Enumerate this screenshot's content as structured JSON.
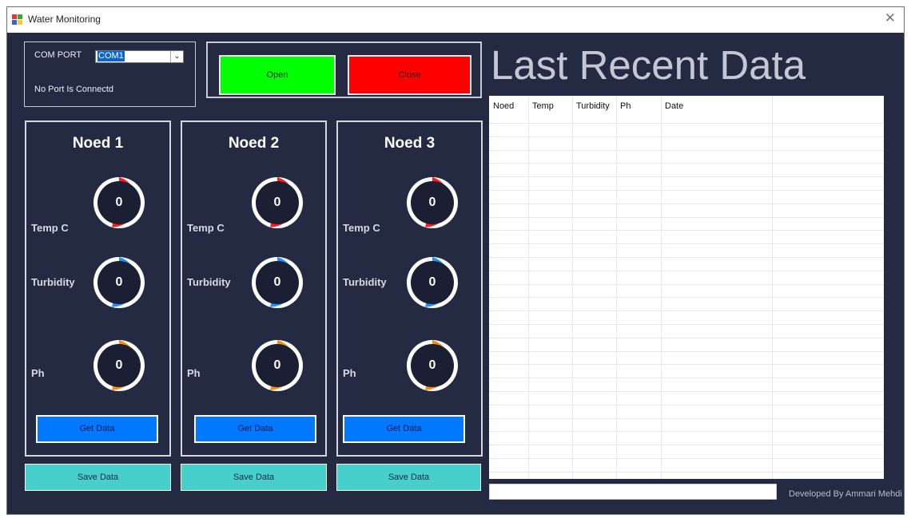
{
  "window": {
    "title": "Water Monitoring",
    "close_glyph": "✕"
  },
  "com": {
    "label": "COM PORT",
    "value": "COM1",
    "status": "No Port Is Connectd"
  },
  "buttons": {
    "open": "Open",
    "close": "Close"
  },
  "nodes": [
    {
      "title": "Noed 1",
      "temp_label": "Temp C",
      "turbidity_label": "Turbidity",
      "ph_label": "Ph",
      "temp": "0",
      "turbidity": "0",
      "ph": "0",
      "get": "Get Data",
      "save": "Save Data"
    },
    {
      "title": "Noed 2",
      "temp_label": "Temp C",
      "turbidity_label": "Turbidity",
      "ph_label": "Ph",
      "temp": "0",
      "turbidity": "0",
      "ph": "0",
      "get": "Get Data",
      "save": "Save Data"
    },
    {
      "title": "Noed 3",
      "temp_label": "Temp C",
      "turbidity_label": "Turbidity",
      "ph_label": "Ph",
      "temp": "0",
      "turbidity": "0",
      "ph": "0",
      "get": "Get Data",
      "save": "Save Data"
    }
  ],
  "gauge_colors": {
    "temp": "#ff1a1a",
    "turbidity": "#1e90ff",
    "ph": "#ff8c00"
  },
  "recent": {
    "heading": "Last Recent Data",
    "columns": [
      "Noed",
      "Temp",
      "Turbidity",
      "Ph",
      "Date"
    ],
    "rows": []
  },
  "footer": {
    "credit": "Developed By Ammari Mehdi"
  }
}
